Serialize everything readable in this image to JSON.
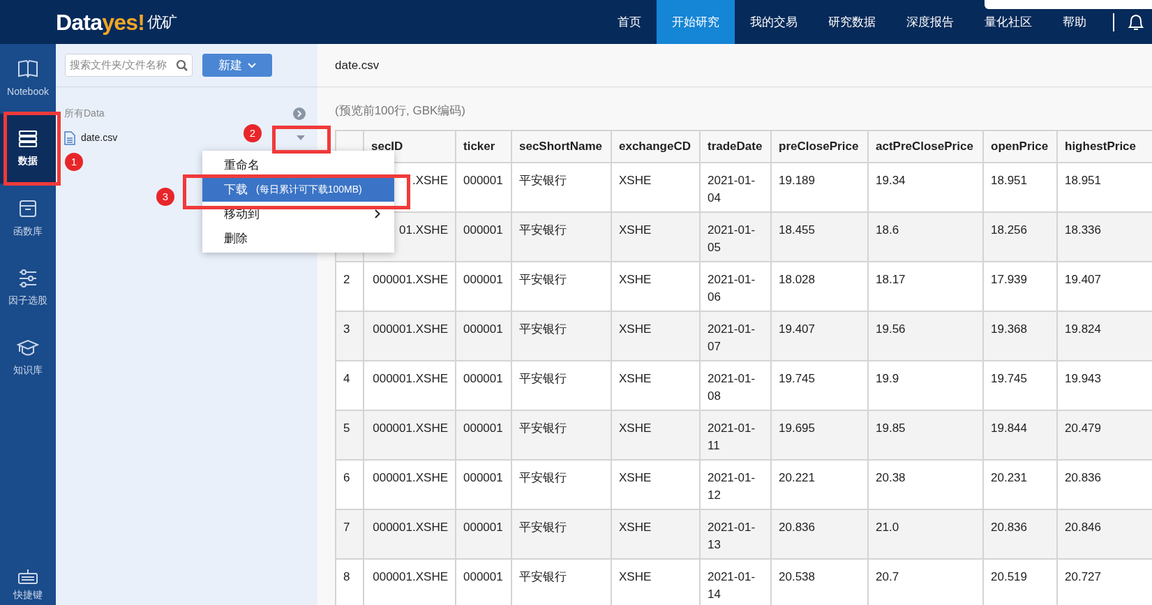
{
  "header": {
    "logo_main": "Data",
    "logo_accent": "yes!",
    "logo_cn": "优矿",
    "nav": [
      {
        "label": "首页",
        "selected": false
      },
      {
        "label": "开始研究",
        "selected": true
      },
      {
        "label": "我的交易",
        "selected": false
      },
      {
        "label": "研究数据",
        "selected": false
      },
      {
        "label": "深度报告",
        "selected": false
      },
      {
        "label": "量化社区",
        "selected": false
      },
      {
        "label": "帮助",
        "selected": false
      }
    ]
  },
  "sidebar": {
    "items": [
      {
        "label": "Notebook",
        "kind": "book",
        "selected": false
      },
      {
        "label": "数据",
        "kind": "data",
        "selected": true
      },
      {
        "label": "函数库",
        "kind": "box",
        "selected": false
      },
      {
        "label": "因子选股",
        "kind": "sliders",
        "selected": false
      },
      {
        "label": "知识库",
        "kind": "cap",
        "selected": false
      }
    ],
    "bottom": {
      "label": "快捷键",
      "kind": "keyboard"
    }
  },
  "file_panel": {
    "search": {
      "placeholder": "搜索文件夹/文件名称"
    },
    "new_button": "新建",
    "section": "所有Data",
    "files": [
      {
        "name": "date.csv"
      }
    ]
  },
  "context_menu": {
    "items": [
      {
        "label": "重命名",
        "selected": false
      },
      {
        "label": "下载",
        "note": "(每日累计可下载100MB)",
        "selected": true
      },
      {
        "label": "移动到",
        "submenu": true,
        "selected": false
      },
      {
        "label": "删除",
        "selected": false
      }
    ]
  },
  "annotations": [
    {
      "number": "1",
      "kind": "sidebar"
    },
    {
      "number": "2",
      "kind": "caret"
    },
    {
      "number": "3",
      "kind": "download"
    }
  ],
  "content": {
    "title": "date.csv",
    "note": "(预览前100行, GBK编码)",
    "table": {
      "columns": [
        "",
        "secID",
        "ticker",
        "secShortName",
        "exchangeCD",
        "tradeDate",
        "preClosePrice",
        "actPreClosePrice",
        "openPrice",
        "highestPrice"
      ],
      "rows": [
        [
          "",
          ".XSHE",
          "000001",
          "平安银行",
          "XSHE",
          "2021-01-04",
          "19.189",
          "19.34",
          "18.951",
          "18.951"
        ],
        [
          "",
          "01.XSHE",
          "000001",
          "平安银行",
          "XSHE",
          "2021-01-05",
          "18.455",
          "18.6",
          "18.256",
          "18.336"
        ],
        [
          "2",
          "000001.XSHE",
          "000001",
          "平安银行",
          "XSHE",
          "2021-01-06",
          "18.028",
          "18.17",
          "17.939",
          "19.407"
        ],
        [
          "3",
          "000001.XSHE",
          "000001",
          "平安银行",
          "XSHE",
          "2021-01-07",
          "19.407",
          "19.56",
          "19.368",
          "19.824"
        ],
        [
          "4",
          "000001.XSHE",
          "000001",
          "平安银行",
          "XSHE",
          "2021-01-08",
          "19.745",
          "19.9",
          "19.745",
          "19.943"
        ],
        [
          "5",
          "000001.XSHE",
          "000001",
          "平安银行",
          "XSHE",
          "2021-01-11",
          "19.695",
          "19.85",
          "19.844",
          "20.479"
        ],
        [
          "6",
          "000001.XSHE",
          "000001",
          "平安银行",
          "XSHE",
          "2021-01-12",
          "20.221",
          "20.38",
          "20.231",
          "20.836"
        ],
        [
          "7",
          "000001.XSHE",
          "000001",
          "平安银行",
          "XSHE",
          "2021-01-13",
          "20.836",
          "21.0",
          "20.836",
          "20.846"
        ],
        [
          "8",
          "000001.XSHE",
          "000001",
          "平安银行",
          "XSHE",
          "2021-01-14",
          "20.538",
          "20.7",
          "20.519",
          "20.727"
        ]
      ]
    }
  }
}
